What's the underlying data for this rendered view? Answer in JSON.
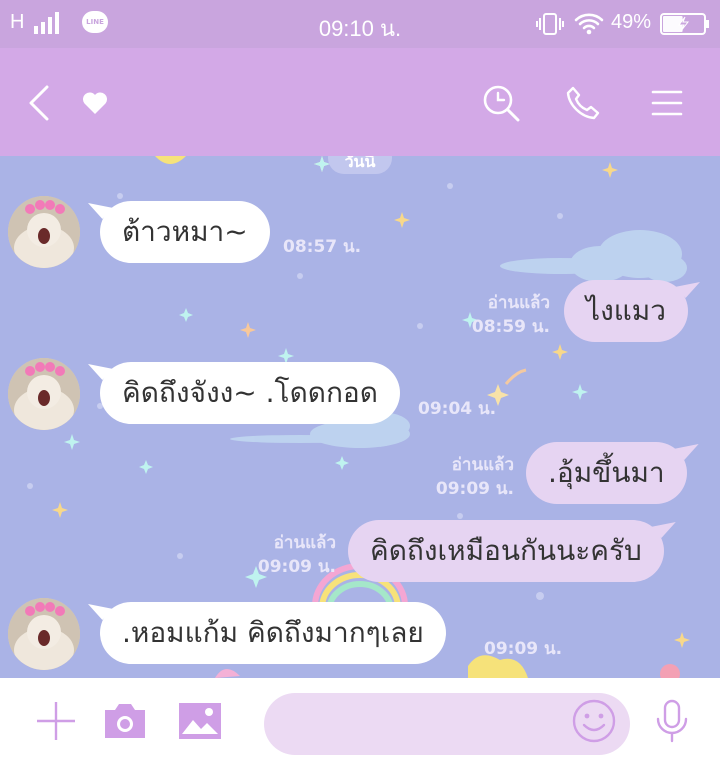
{
  "status_bar": {
    "network": "H",
    "app_badge": "LINE",
    "time": "09:10 น.",
    "battery_percent": "49%",
    "battery_level": 0.49,
    "icons": [
      "signal-icon",
      "line-app-icon",
      "vibrate-icon",
      "wifi-icon",
      "battery-charging-icon"
    ]
  },
  "header": {
    "icons": [
      "back-arrow-icon",
      "heart-icon",
      "search-icon",
      "phone-icon",
      "menu-icon"
    ]
  },
  "chat": {
    "top_partial_text": "วันนี้",
    "messages": [
      {
        "direction": "in",
        "text": "ต้าวหมา~",
        "time": "08:57 น."
      },
      {
        "direction": "out",
        "text": "ไงแมว",
        "read": "อ่านแล้ว",
        "time": "08:59 น."
      },
      {
        "direction": "in",
        "text": "คิดถึงจังง~ .โดดกอด",
        "time": "09:04 น."
      },
      {
        "direction": "out",
        "text": ".อุ้มขึ้นมา",
        "read": "อ่านแล้ว",
        "time": "09:09 น."
      },
      {
        "direction": "out",
        "text": "คิดถึงเหมือนกันนะครับ",
        "read": "อ่านแล้ว",
        "time": "09:09 น."
      },
      {
        "direction": "in",
        "text": ".หอมแก้ม คิดถึงมากๆเลย",
        "time": "09:09 น."
      }
    ]
  },
  "input_bar": {
    "placeholder": "",
    "icons": [
      "plus-icon",
      "camera-icon",
      "image-icon",
      "emoji-icon",
      "microphone-icon"
    ]
  },
  "colors": {
    "status_bar": "#c9a5de",
    "header": "#d3a9e7",
    "chat_background": "#aab3e6",
    "bubble_incoming": "#ffffff",
    "bubble_outgoing": "#e6d4f2",
    "accent_icon": "#cf9ee6"
  }
}
